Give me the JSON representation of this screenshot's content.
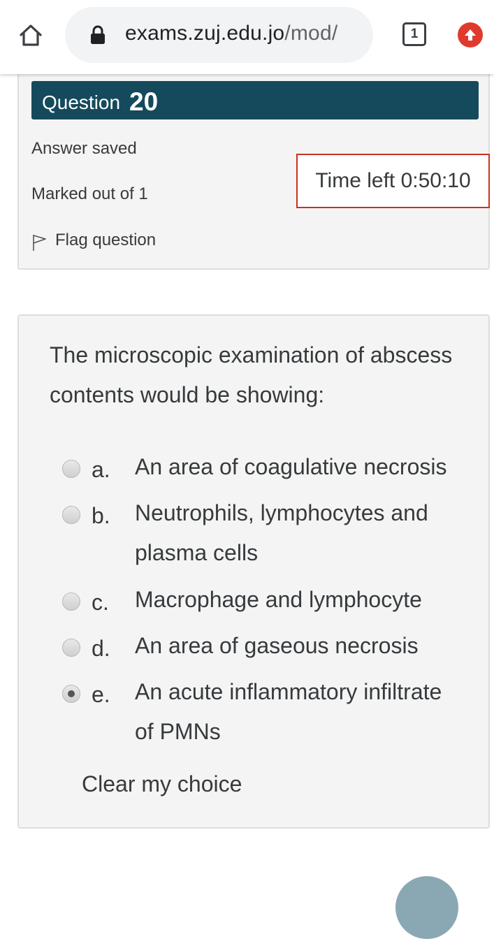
{
  "browser": {
    "url_host": "exams.zuj.edu.jo",
    "url_path": "/mod/",
    "tab_count": "1"
  },
  "question_info": {
    "label": "Question",
    "number": "20",
    "status": "Answer saved",
    "marks": "Marked out of 1",
    "flag_label": "Flag question"
  },
  "timer": {
    "text": "Time left 0:50:10"
  },
  "question": {
    "text_line1": "The microscopic examination of abscess",
    "text_line2": "contents would be showing:",
    "options": [
      {
        "letter": "a.",
        "line1": "An area of coagulative necrosis",
        "line2": "",
        "checked": false
      },
      {
        "letter": "b.",
        "line1": "Neutrophils, lymphocytes and",
        "line2": "plasma cells",
        "checked": false
      },
      {
        "letter": "c.",
        "line1": "Macrophage and lymphocyte",
        "line2": "",
        "checked": false
      },
      {
        "letter": "d.",
        "line1": "An area of gaseous necrosis",
        "line2": "",
        "checked": false
      },
      {
        "letter": "e.",
        "line1": "An acute inflammatory infiltrate",
        "line2": "of PMNs",
        "checked": true
      }
    ],
    "clear_label": "Clear my choice"
  },
  "colors": {
    "header_bg": "#154a5c",
    "timer_border": "#ca3120",
    "update_icon": "#e03a2e"
  }
}
